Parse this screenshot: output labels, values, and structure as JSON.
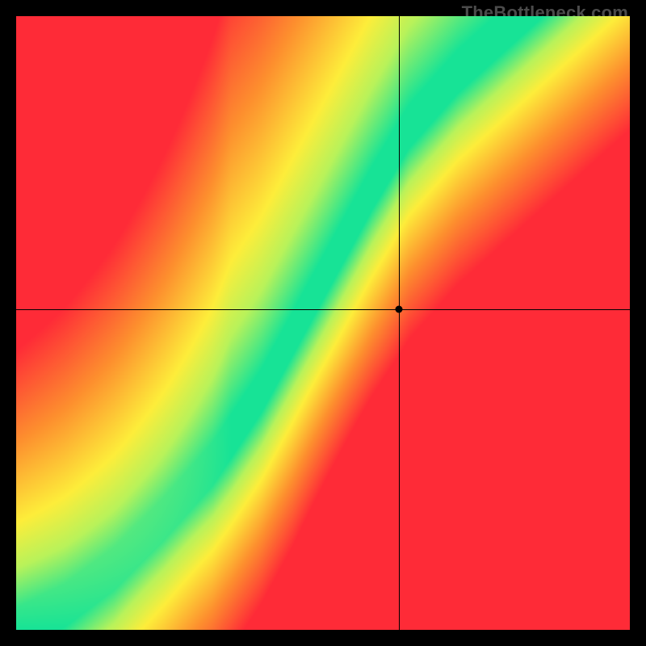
{
  "source_label": "TheBottleneck.com",
  "colors": {
    "red": "#fe2b37",
    "orange": "#fd8f2e",
    "yellow": "#fded3a",
    "lightgreen": "#b8f25a",
    "green": "#17e396"
  },
  "crosshair": {
    "x_frac": 0.624,
    "y_frac": 0.478
  },
  "marker_dot": {
    "x_frac": 0.624,
    "y_frac": 0.478
  },
  "chart_data": {
    "type": "heatmap",
    "title": "",
    "xlabel": "",
    "ylabel": "",
    "xlim": [
      0,
      1
    ],
    "ylim": [
      0,
      1
    ],
    "description": "Background is a smooth red→orange→yellow→green heat gradient. A thin emerald-green optimal band curves from the bottom-left corner upward; below the band the field shifts quickly to red, above it fades through yellow/orange to red again at the top-left. Thin black cross-hairs and a black dot mark a selected point.",
    "optimal_curve": [
      {
        "x": 0.0,
        "y": 0.0
      },
      {
        "x": 0.08,
        "y": 0.04
      },
      {
        "x": 0.16,
        "y": 0.1
      },
      {
        "x": 0.24,
        "y": 0.18
      },
      {
        "x": 0.32,
        "y": 0.27
      },
      {
        "x": 0.4,
        "y": 0.39
      },
      {
        "x": 0.46,
        "y": 0.5
      },
      {
        "x": 0.52,
        "y": 0.61
      },
      {
        "x": 0.58,
        "y": 0.72
      },
      {
        "x": 0.64,
        "y": 0.82
      },
      {
        "x": 0.72,
        "y": 0.91
      },
      {
        "x": 0.82,
        "y": 1.0
      }
    ],
    "band_half_width": 0.035,
    "marker": {
      "x": 0.624,
      "y": 0.522
    },
    "field_model": {
      "comment": "colour at (x,y) = ramp from green at the curve outward to red; asymmetry so region below curve reddens faster; additional left-column red bias.",
      "below_red_scale": 3.2,
      "above_red_scale": 1.4,
      "left_bias_strength": 0.9
    }
  }
}
